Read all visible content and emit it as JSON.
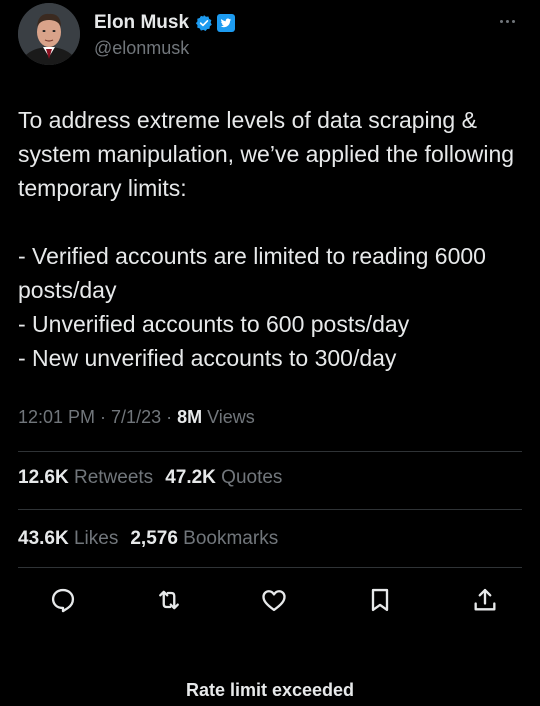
{
  "author": {
    "name": "Elon Musk",
    "handle": "@elonmusk",
    "verified": true
  },
  "tweet": {
    "text": "To address extreme levels of data scraping & system manipulation, we’ve applied the following temporary limits:\n\n- Verified accounts are limited to reading 6000 posts/day\n- Unverified accounts to 600 posts/day\n- New unverified accounts to 300/day",
    "time": "12:01 PM",
    "sep1": " · ",
    "date": "7/1/23",
    "sep2": " · ",
    "views_count": "8M",
    "views_label": " Views"
  },
  "stats": {
    "retweets_count": "12.6K",
    "retweets_label": "Retweets",
    "quotes_count": "47.2K",
    "quotes_label": "Quotes",
    "likes_count": "43.6K",
    "likes_label": "Likes",
    "bookmarks_count": "2,576",
    "bookmarks_label": "Bookmarks"
  },
  "actions": [
    "reply-icon",
    "retweet-icon",
    "like-icon",
    "bookmark-icon",
    "share-icon"
  ],
  "banner": {
    "text": "Rate limit exceeded"
  },
  "colors": {
    "background": "#000000",
    "primary_text": "#e7e9ea",
    "secondary_text": "#71767b",
    "divider": "#2f3336",
    "verified_blue": "#1d9bf0"
  }
}
